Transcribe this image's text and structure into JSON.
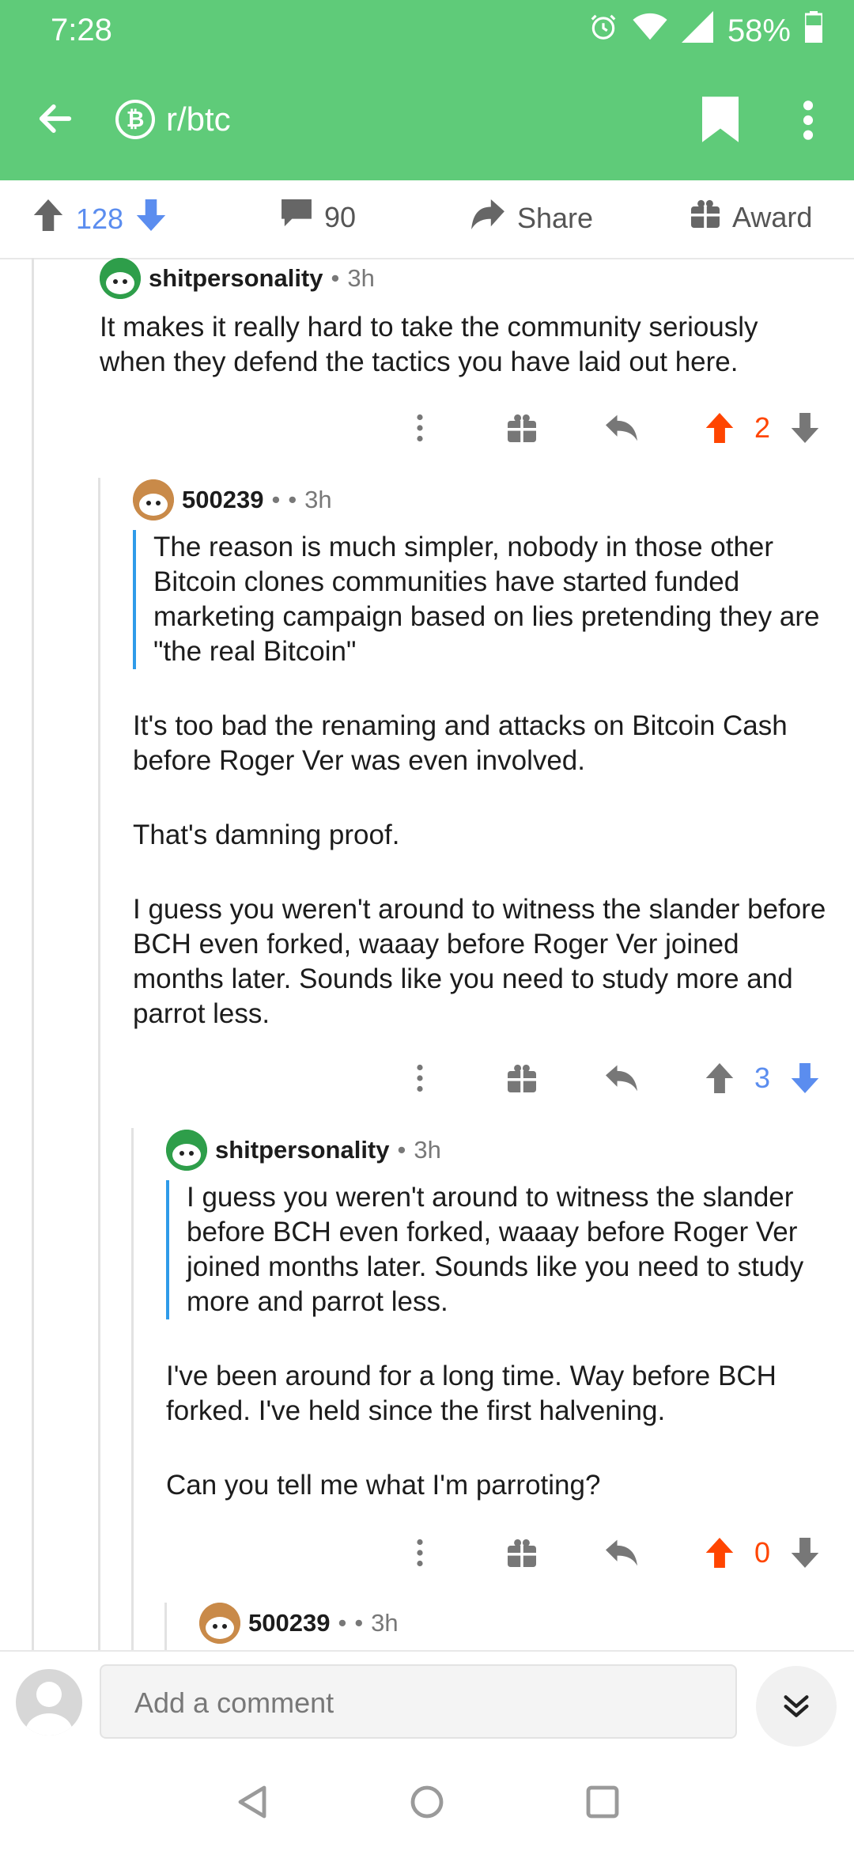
{
  "status": {
    "time": "7:28",
    "battery": "58%"
  },
  "appbar": {
    "subreddit": "r/btc",
    "coin_symbol": "₿"
  },
  "post_actions": {
    "score": "128",
    "comments": "90",
    "share": "Share",
    "award": "Award"
  },
  "comments": [
    {
      "author": "shitpersonality",
      "age": "3h",
      "body": [
        "It makes it really hard to take the community seriously when they defend the tactics you have laid out here."
      ],
      "score": "2",
      "vote": "up"
    },
    {
      "author": "500239",
      "age": "3h",
      "quote": "The reason is much simpler, nobody in those other Bitcoin clones communities have started funded marketing campaign based on lies pretending they are \"the real Bitcoin\"",
      "body": [
        "It's too bad the renaming and attacks on Bitcoin Cash before Roger Ver was even involved.",
        "That's damning proof.",
        "I guess you weren't around to witness the slander before BCH even forked, waaay before Roger Ver joined months later. Sounds like you need to study more and parrot less."
      ],
      "score": "3",
      "vote": "down"
    },
    {
      "author": "shitpersonality",
      "age": "3h",
      "quote": "I guess you weren't around to witness the slander before BCH even forked, waaay before Roger Ver joined months later. Sounds like you need to study more and parrot less.",
      "body": [
        "I've been around for a long time. Way before BCH forked. I've held since the first halvening.",
        "Can you tell me what I'm parroting?"
      ],
      "score": "0",
      "vote": "up"
    },
    {
      "author": "500239",
      "age": "3h"
    }
  ],
  "composer": {
    "placeholder": "Add a comment"
  },
  "colors": {
    "accent_green": "#5fcb79",
    "upvote": "#ff4500",
    "downvote": "#5b8def",
    "quote_bar": "#2f9be9"
  }
}
